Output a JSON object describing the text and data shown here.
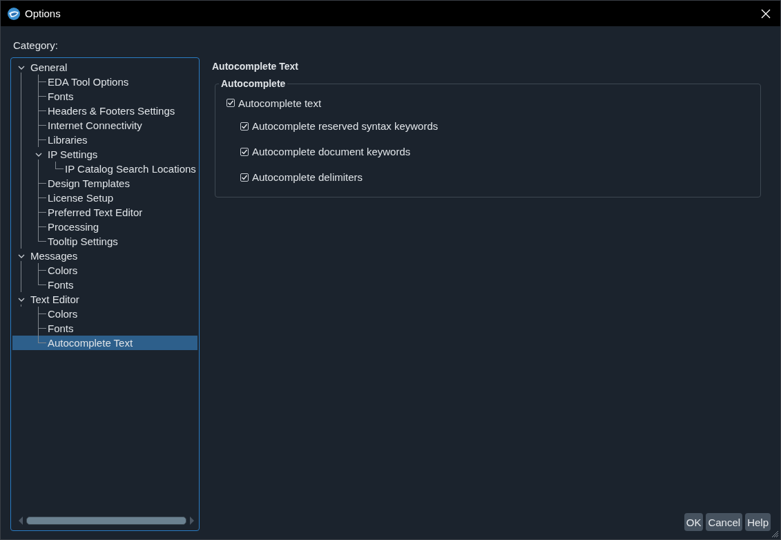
{
  "window": {
    "title": "Options"
  },
  "category_label": "Category:",
  "tree": [
    {
      "label": "General",
      "expanded": true,
      "selected": false,
      "children": [
        {
          "label": "EDA Tool Options",
          "selected": false
        },
        {
          "label": "Fonts",
          "selected": false
        },
        {
          "label": "Headers & Footers Settings",
          "selected": false
        },
        {
          "label": "Internet Connectivity",
          "selected": false
        },
        {
          "label": "Libraries",
          "selected": false
        },
        {
          "label": "IP Settings",
          "expanded": true,
          "selected": false,
          "children": [
            {
              "label": "IP Catalog Search Locations",
              "selected": false
            }
          ]
        },
        {
          "label": "Design Templates",
          "selected": false
        },
        {
          "label": "License Setup",
          "selected": false
        },
        {
          "label": "Preferred Text Editor",
          "selected": false
        },
        {
          "label": "Processing",
          "selected": false
        },
        {
          "label": "Tooltip Settings",
          "selected": false
        }
      ]
    },
    {
      "label": "Messages",
      "expanded": true,
      "selected": false,
      "children": [
        {
          "label": "Colors",
          "selected": false
        },
        {
          "label": "Fonts",
          "selected": false
        }
      ]
    },
    {
      "label": "Text Editor",
      "expanded": true,
      "selected": false,
      "children": [
        {
          "label": "Colors",
          "selected": false
        },
        {
          "label": "Fonts",
          "selected": false
        },
        {
          "label": "Autocomplete Text",
          "selected": true
        }
      ]
    }
  ],
  "page_title": "Autocomplete Text",
  "group": {
    "title": "Autocomplete",
    "options": [
      {
        "label": "Autocomplete text",
        "checked": true,
        "children": [
          {
            "label": "Autocomplete reserved syntax keywords",
            "checked": true
          },
          {
            "label": "Autocomplete document keywords",
            "checked": true
          },
          {
            "label": "Autocomplete delimiters",
            "checked": true
          }
        ]
      }
    ]
  },
  "buttons": [
    "OK",
    "Cancel",
    "Help"
  ]
}
